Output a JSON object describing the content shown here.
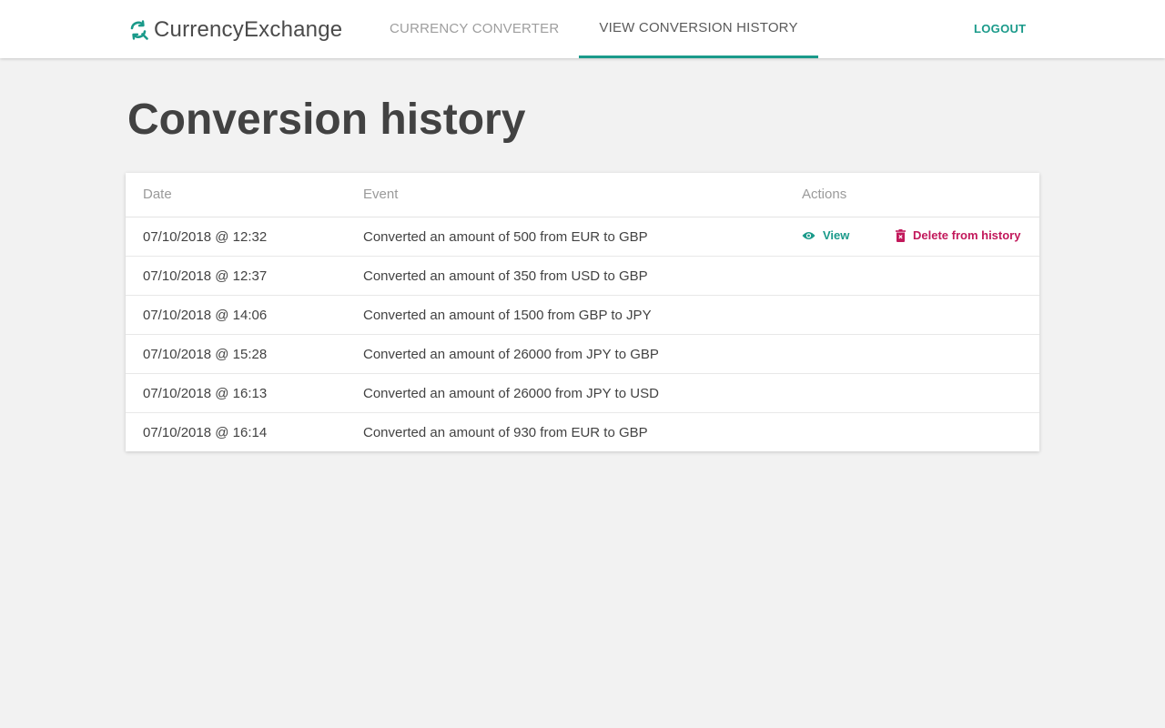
{
  "brand": {
    "name_part1": "Currency",
    "name_part2": "Exchange",
    "logo_icon": "refresh-search-icon",
    "accent_color": "#1a9a8a"
  },
  "nav": {
    "tabs": [
      {
        "label": "CURRENCY CONVERTER",
        "active": false
      },
      {
        "label": "VIEW CONVERSION HISTORY",
        "active": true
      }
    ],
    "logout_label": "LOGOUT"
  },
  "page": {
    "title": "Conversion history"
  },
  "table": {
    "headers": {
      "date": "Date",
      "event": "Event",
      "actions": "Actions"
    },
    "actions": {
      "view_label": "View",
      "view_icon": "eye-icon",
      "delete_label": "Delete from history",
      "delete_icon": "trash-icon",
      "delete_color": "#c2185b"
    },
    "rows": [
      {
        "date": "07/10/2018 @ 12:32",
        "event": "Converted an amount of 500 from EUR to GBP"
      },
      {
        "date": "07/10/2018 @ 12:37",
        "event": "Converted an amount of 350 from USD to GBP"
      },
      {
        "date": "07/10/2018 @ 14:06",
        "event": "Converted an amount of 1500 from GBP to JPY"
      },
      {
        "date": "07/10/2018 @ 15:28",
        "event": "Converted an amount of 26000 from JPY to GBP"
      },
      {
        "date": "07/10/2018 @ 16:13",
        "event": "Converted an amount of 26000 from JPY to USD"
      },
      {
        "date": "07/10/2018 @ 16:14",
        "event": "Converted an amount of 930 from EUR to GBP"
      }
    ]
  }
}
